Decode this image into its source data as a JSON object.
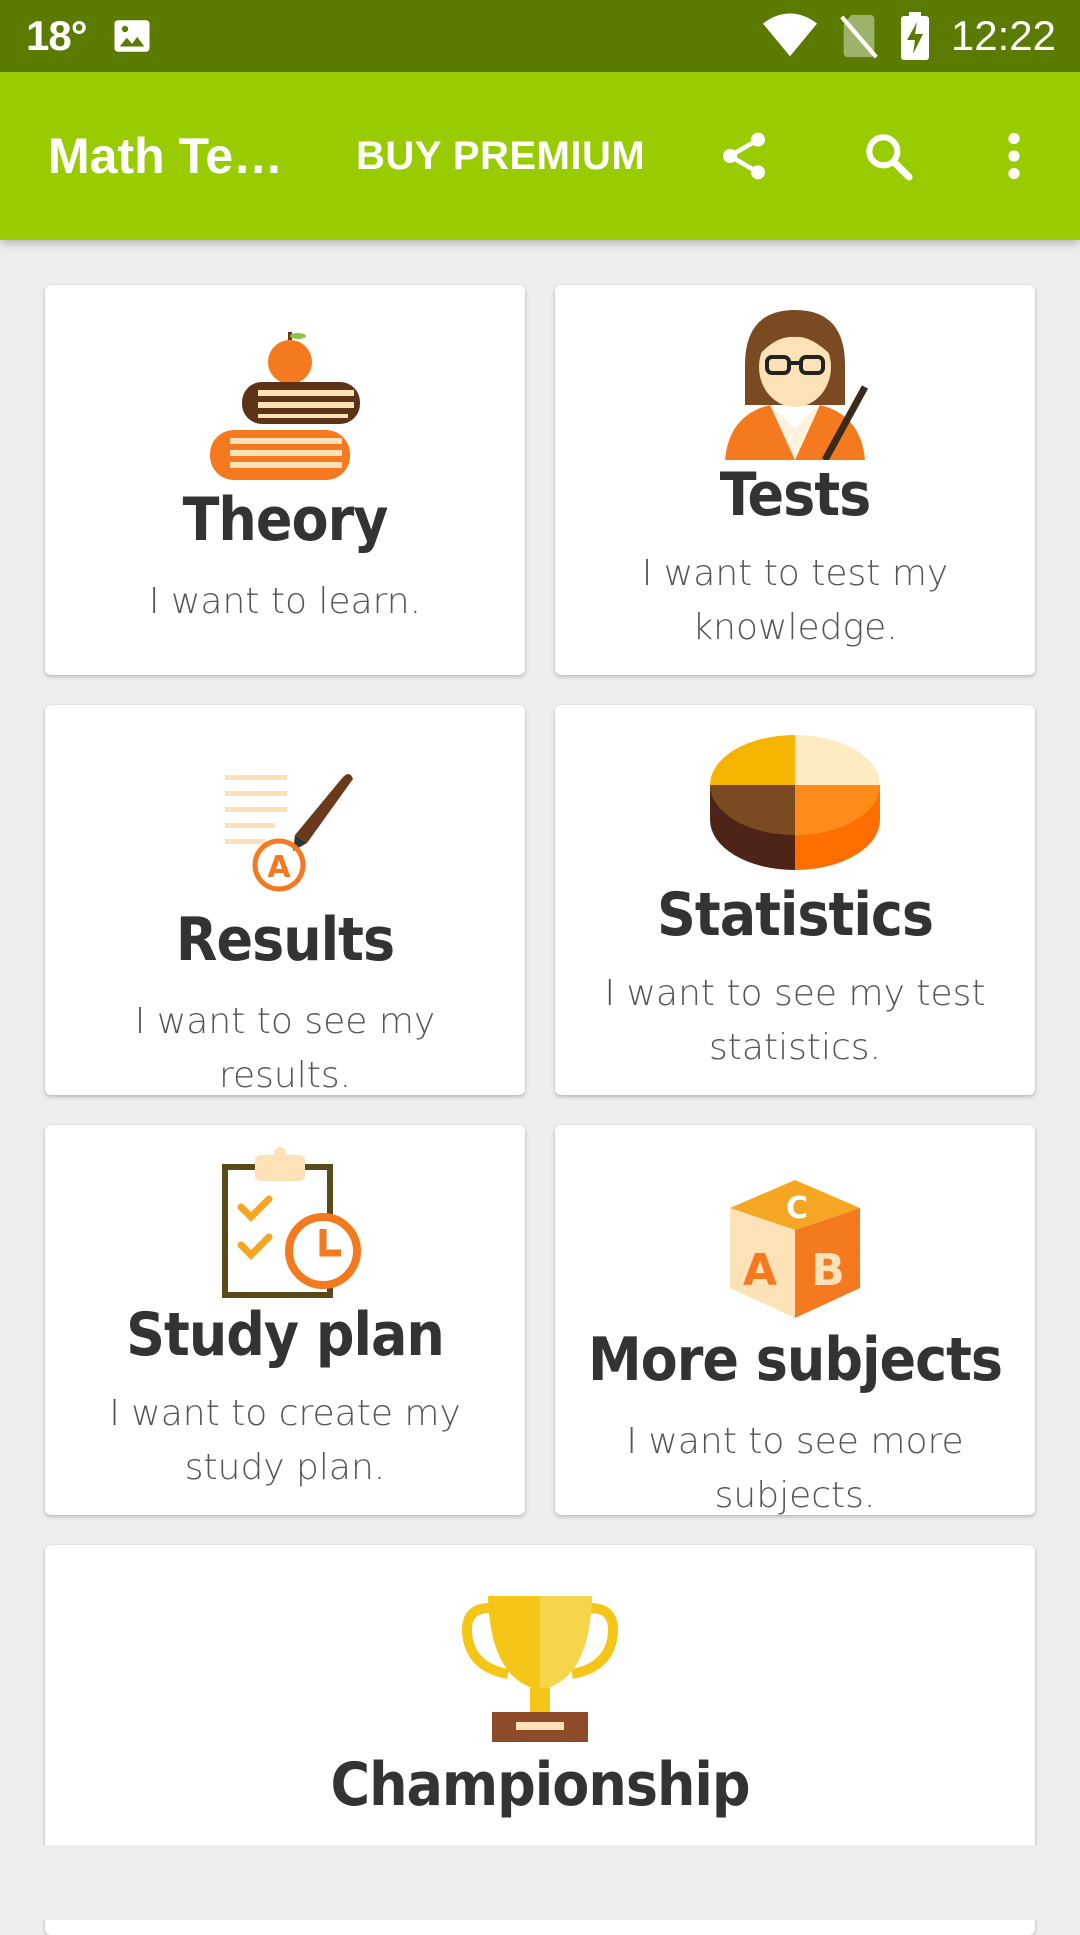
{
  "status_bar": {
    "temperature": "18°",
    "time": "12:22",
    "icons": [
      "image-notification-icon",
      "wifi-icon",
      "no-sim-icon",
      "battery-charging-icon"
    ]
  },
  "app_bar": {
    "title": "Math Te…",
    "buy_premium": "BUY PREMIUM",
    "icons": [
      "share-icon",
      "search-icon",
      "more-vert-icon"
    ]
  },
  "cards": [
    {
      "title": "Theory",
      "description": "I want to learn.",
      "icon": "books-apple-icon"
    },
    {
      "title": "Tests",
      "description": "I want to test my knowledge.",
      "icon": "teacher-icon"
    },
    {
      "title": "Results",
      "description": "I want to see my results.",
      "icon": "graded-paper-pen-icon"
    },
    {
      "title": "Statistics",
      "description": "I want to see my test statistics.",
      "icon": "pie-chart-icon"
    },
    {
      "title": "Study plan",
      "description": "I want to create my study plan.",
      "icon": "clipboard-clock-icon"
    },
    {
      "title": "More subjects",
      "description": "I want to see more subjects.",
      "icon": "abc-block-icon"
    },
    {
      "title": "Championship",
      "description": "",
      "icon": "trophy-icon"
    }
  ],
  "colors": {
    "status_bar": "#5b7a00",
    "app_bar": "#99cc00",
    "background": "#eeeeee"
  }
}
